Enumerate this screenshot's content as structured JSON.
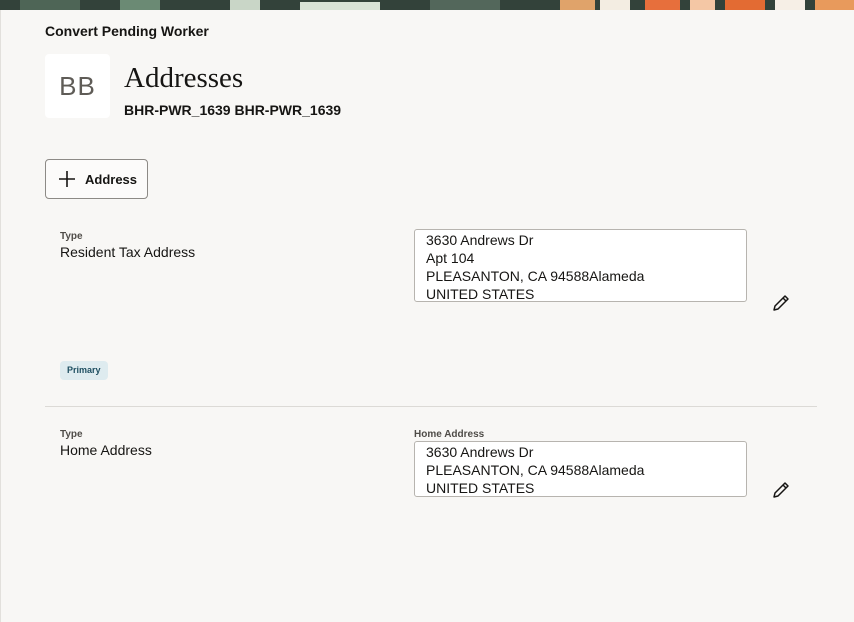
{
  "header": {
    "page_label": "Convert Pending Worker",
    "avatar_initials": "BB",
    "title": "Addresses",
    "subtitle": "BHR-PWR_1639 BHR-PWR_1639"
  },
  "toolbar": {
    "add_label": "Address",
    "add_icon": "plus-icon"
  },
  "addresses": [
    {
      "type_label": "Type",
      "type_value": "Resident Tax Address",
      "address_label": "",
      "lines": [
        "3630 Andrews Dr",
        "Apt 104",
        "PLEASANTON, CA 94588Alameda",
        "UNITED STATES"
      ],
      "badge": "Primary",
      "edit_icon": "pencil-icon"
    },
    {
      "type_label": "Type",
      "type_value": "Home Address",
      "address_label": "Home Address",
      "lines": [
        "3630 Andrews Dr",
        "PLEASANTON, CA 94588Alameda",
        "UNITED STATES"
      ],
      "edit_icon": "pencil-icon"
    }
  ],
  "colors": {
    "background": "#f8f7f5",
    "badge_bg": "#deebef",
    "badge_text": "#1f4f61",
    "text": "#161513"
  }
}
